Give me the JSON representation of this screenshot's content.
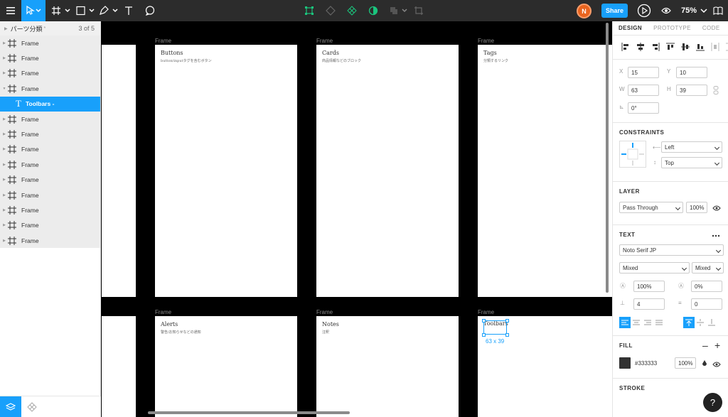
{
  "toolbar": {
    "zoom": "75%",
    "share_label": "Share",
    "avatar_initial": "N"
  },
  "left_panel": {
    "page_name": "パーツ分類",
    "page_count": "3 of 5",
    "layers": [
      {
        "label": "Frame"
      },
      {
        "label": "Frame"
      },
      {
        "label": "Frame"
      },
      {
        "label": "Frame"
      },
      {
        "label": "Toolbars -"
      },
      {
        "label": "Frame"
      },
      {
        "label": "Frame"
      },
      {
        "label": "Frame"
      },
      {
        "label": "Frame"
      },
      {
        "label": "Frame"
      },
      {
        "label": "Frame"
      },
      {
        "label": "Frame"
      },
      {
        "label": "Frame"
      },
      {
        "label": "Frame"
      }
    ]
  },
  "canvas": {
    "frames": [
      {
        "label": "Frame",
        "title": "Buttons",
        "subtitle": "button/inputタグを含むボタン"
      },
      {
        "label": "Frame",
        "title": "Cards",
        "subtitle": "商品情報などのブロック"
      },
      {
        "label": "Frame",
        "title": "Tags",
        "subtitle": "分類するリンク"
      },
      {
        "label": "Frame",
        "title": "Alerts",
        "subtitle": "警告/お知らせなどの通知"
      },
      {
        "label": "Frame",
        "title": "Notes",
        "subtitle": "注釈"
      },
      {
        "label": "Frame",
        "title": "Toolbars",
        "subtitle": ""
      }
    ],
    "selection_dims": "63 x 39"
  },
  "right_panel": {
    "tabs": [
      "DESIGN",
      "PROTOTYPE",
      "CODE"
    ],
    "active_tab": "DESIGN",
    "x": "15",
    "y": "10",
    "w": "63",
    "h": "39",
    "rotation": "0°",
    "constraints_title": "CONSTRAINTS",
    "constraint_h": "Left",
    "constraint_v": "Top",
    "layer_title": "LAYER",
    "blend_mode": "Pass Through",
    "layer_opacity": "100%",
    "text_title": "TEXT",
    "font_family": "Noto Serif JP",
    "font_style": "Mixed",
    "font_size": "Mixed",
    "line_height": "100%",
    "letter_spacing": "0%",
    "paragraph_spacing": "4",
    "paragraph_indent": "0",
    "fill_title": "FILL",
    "fill_hex": "#333333",
    "fill_opacity": "100%",
    "stroke_title": "STROKE"
  },
  "colors": {
    "accent": "#18a0fb",
    "toolbar_bg": "#2c2c2c",
    "fill_swatch": "#333333",
    "avatar": "#e9641f"
  }
}
